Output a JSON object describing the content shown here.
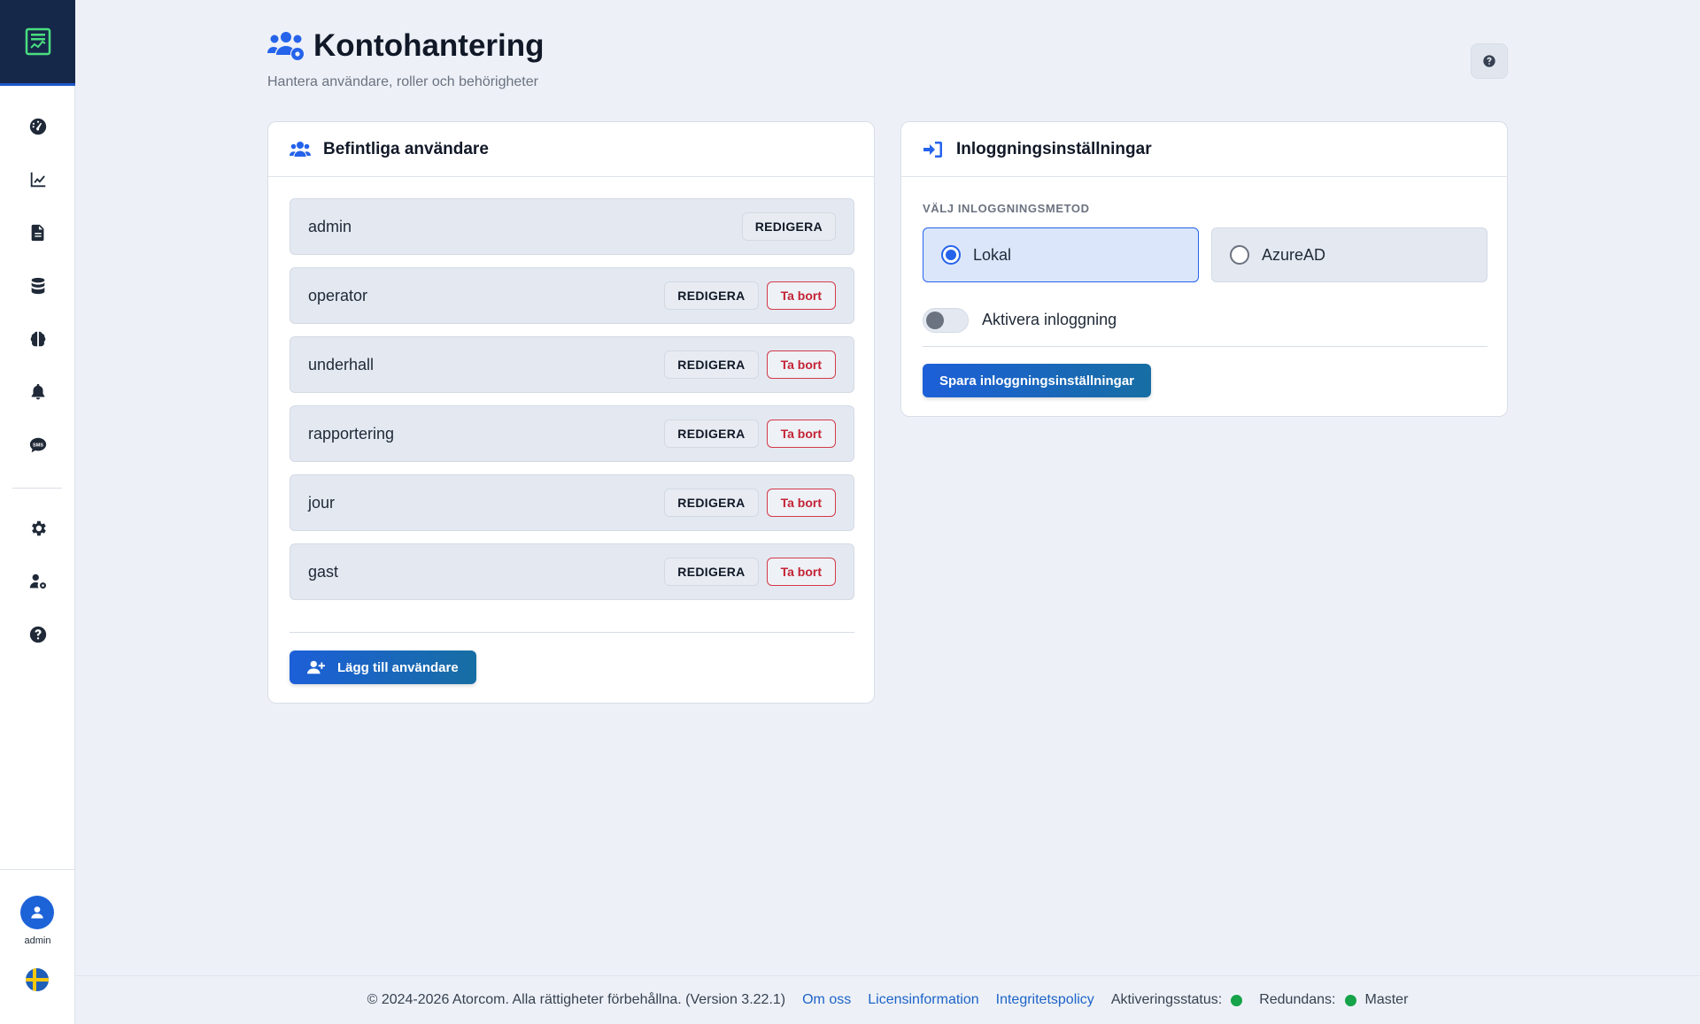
{
  "sidebar": {
    "logo_icon": "report-logo-icon",
    "nav": [
      {
        "icon": "speedometer-icon"
      },
      {
        "icon": "line-chart-icon"
      },
      {
        "icon": "document-icon"
      },
      {
        "icon": "database-icon"
      },
      {
        "icon": "brain-icon"
      },
      {
        "icon": "bell-icon"
      },
      {
        "icon": "sms-icon",
        "label": "SMS"
      },
      {
        "icon": "gear-icon"
      },
      {
        "icon": "user-cog-icon"
      },
      {
        "icon": "question-icon"
      }
    ],
    "user_label": "admin"
  },
  "header": {
    "title": "Kontohantering",
    "subtitle": "Hantera användare, roller och behörigheter"
  },
  "users_card": {
    "title": "Befintliga användare",
    "edit_label": "REDIGERA",
    "delete_label": "Ta bort",
    "users": [
      {
        "name": "admin",
        "deletable": false
      },
      {
        "name": "operator",
        "deletable": true
      },
      {
        "name": "underhall",
        "deletable": true
      },
      {
        "name": "rapportering",
        "deletable": true
      },
      {
        "name": "jour",
        "deletable": true
      },
      {
        "name": "gast",
        "deletable": true
      }
    ],
    "add_label": "Lägg till användare"
  },
  "login_card": {
    "title": "Inloggningsinställningar",
    "method_label": "VÄLJ INLOGGNINGSMETOD",
    "methods": [
      {
        "label": "Lokal",
        "selected": true
      },
      {
        "label": "AzureAD",
        "selected": false
      }
    ],
    "toggle_label": "Aktivera inloggning",
    "toggle_on": false,
    "save_label": "Spara inloggningsinställningar"
  },
  "footer": {
    "copyright": "© 2024-2026 Atorcom. Alla rättigheter förbehållna. (Version 3.22.1)",
    "about": "Om oss",
    "license": "Licensinformation",
    "privacy": "Integritetspolicy",
    "activation_label": "Aktiveringsstatus:",
    "redundancy_label": "Redundans:",
    "redundancy_value": "Master",
    "status_color": "#16a34a"
  },
  "colors": {
    "accent": "#2563eb",
    "danger": "#c42336",
    "sidebar_header": "#16284a"
  }
}
